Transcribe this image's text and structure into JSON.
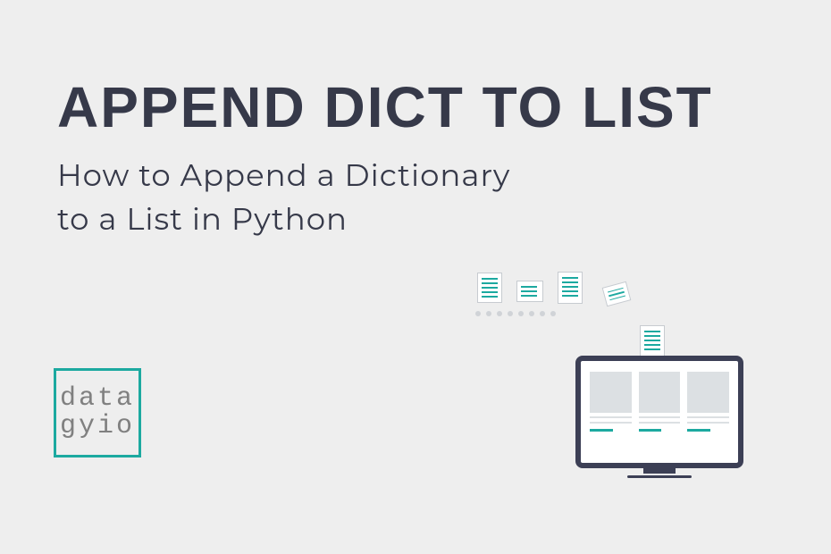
{
  "header": {
    "title": "APPEND DICT TO LIST",
    "subtitle_line1": "How to Append a Dictionary",
    "subtitle_line2": "to a List in Python"
  },
  "logo": {
    "line1": "data",
    "line2": "gyio"
  },
  "colors": {
    "background": "#eeeeee",
    "text_dark": "#363949",
    "accent_teal": "#1ca9a0",
    "logo_gray": "#808080",
    "monitor_frame": "#3c3f55",
    "light_gray": "#dce0e3"
  }
}
